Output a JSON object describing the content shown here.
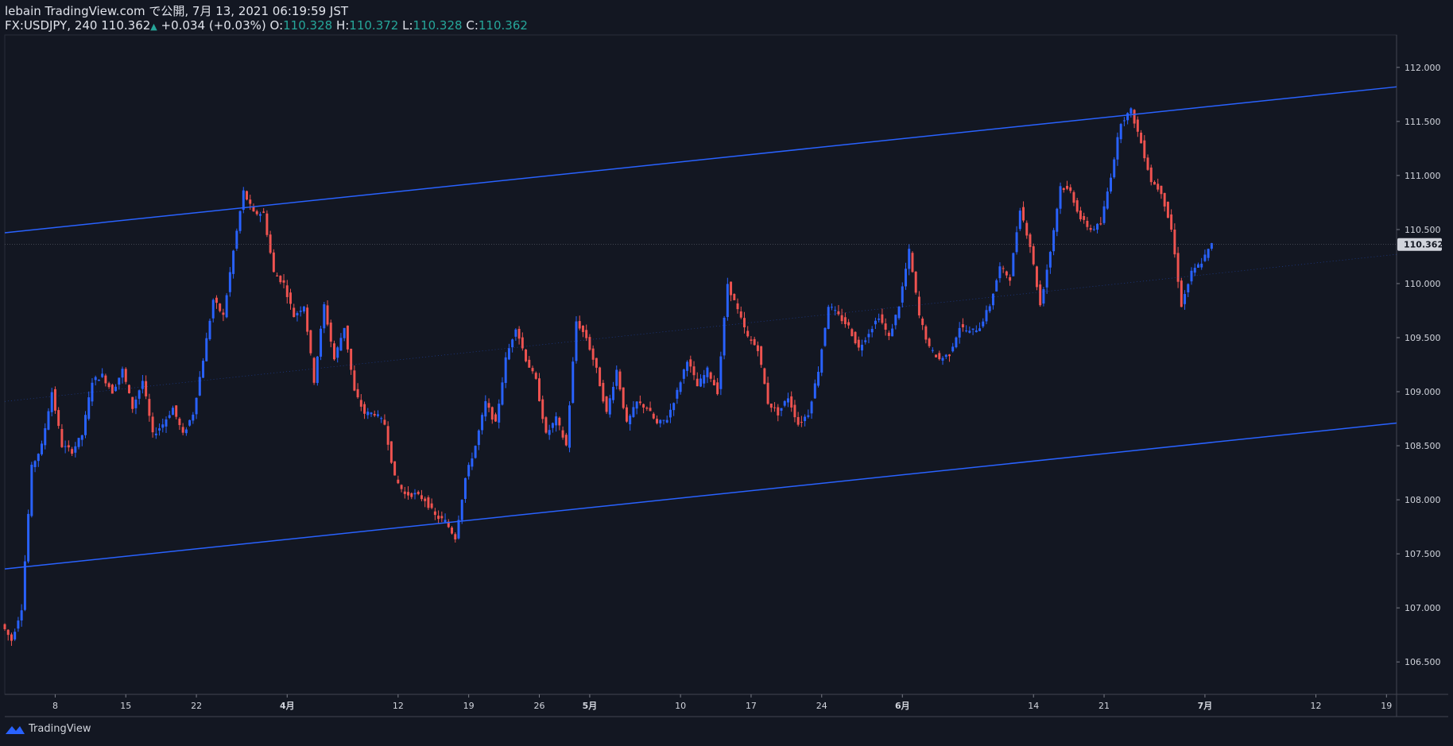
{
  "header": {
    "publish_line": "lebain TradingView.com で公開, 7月 13, 2021 06:19:59 JST",
    "symbol": "FX:USDJPY, 240",
    "last": "110.362",
    "change": "+0.034 (+0.03%)",
    "o_label": "O:",
    "o_value": "110.328",
    "h_label": "H:",
    "h_value": "110.372",
    "l_label": "L:",
    "l_value": "110.328",
    "c_label": "C:",
    "c_value": "110.362"
  },
  "footer": {
    "brand": "TradingView",
    "icon": "tradingview-logo-icon"
  },
  "colors": {
    "background": "#131722",
    "up": "#2962ff",
    "down": "#ef5350",
    "channel": "#2962ff",
    "axis_text": "#d1d4dc",
    "price_label_bg": "#d1d4dc"
  },
  "chart_data": {
    "type": "candlestick",
    "symbol": "FX:USDJPY",
    "interval": "240",
    "ylim": [
      106.2,
      112.3
    ],
    "y_ticks": [
      "106.500",
      "107.000",
      "107.500",
      "108.000",
      "108.500",
      "109.000",
      "109.500",
      "110.000",
      "110.500",
      "111.000",
      "111.500",
      "112.000"
    ],
    "x_ticks": [
      {
        "label": "8",
        "day": 8
      },
      {
        "label": "15",
        "day": 15
      },
      {
        "label": "22",
        "day": 22
      },
      {
        "label": "4月",
        "day": 31
      },
      {
        "label": "12",
        "day": 42
      },
      {
        "label": "19",
        "day": 49
      },
      {
        "label": "26",
        "day": 56
      },
      {
        "label": "5月",
        "day": 61
      },
      {
        "label": "10",
        "day": 70
      },
      {
        "label": "17",
        "day": 77
      },
      {
        "label": "24",
        "day": 84
      },
      {
        "label": "6月",
        "day": 92
      },
      {
        "label": "14",
        "day": 105
      },
      {
        "label": "21",
        "day": 112
      },
      {
        "label": "7月",
        "day": 122
      },
      {
        "label": "12",
        "day": 133
      },
      {
        "label": "19",
        "day": 140
      }
    ],
    "x_range_days": [
      3,
      141
    ],
    "last_price": "110.362",
    "price_path": [
      [
        3,
        106.85
      ],
      [
        4,
        106.7
      ],
      [
        5,
        107.0
      ],
      [
        6,
        108.3
      ],
      [
        7,
        108.5
      ],
      [
        8,
        109.0
      ],
      [
        9,
        108.5
      ],
      [
        10,
        108.45
      ],
      [
        11,
        108.6
      ],
      [
        12,
        109.1
      ],
      [
        13,
        109.15
      ],
      [
        14,
        109.0
      ],
      [
        15,
        109.2
      ],
      [
        16,
        108.85
      ],
      [
        17,
        109.1
      ],
      [
        18,
        108.6
      ],
      [
        19,
        108.7
      ],
      [
        20,
        108.85
      ],
      [
        21,
        108.6
      ],
      [
        22,
        108.8
      ],
      [
        23,
        109.3
      ],
      [
        24,
        109.85
      ],
      [
        25,
        109.7
      ],
      [
        26,
        110.3
      ],
      [
        27,
        110.85
      ],
      [
        28,
        110.65
      ],
      [
        29,
        110.65
      ],
      [
        30,
        110.1
      ],
      [
        31,
        110.0
      ],
      [
        32,
        109.7
      ],
      [
        33,
        109.8
      ],
      [
        34,
        109.1
      ],
      [
        35,
        109.8
      ],
      [
        36,
        109.3
      ],
      [
        37,
        109.6
      ],
      [
        38,
        109.0
      ],
      [
        39,
        108.8
      ],
      [
        40,
        108.8
      ],
      [
        41,
        108.7
      ],
      [
        42,
        108.2
      ],
      [
        43,
        108.05
      ],
      [
        44,
        108.05
      ],
      [
        45,
        108.0
      ],
      [
        46,
        107.85
      ],
      [
        47,
        107.8
      ],
      [
        48,
        107.65
      ],
      [
        49,
        108.2
      ],
      [
        50,
        108.5
      ],
      [
        51,
        108.9
      ],
      [
        52,
        108.7
      ],
      [
        53,
        109.3
      ],
      [
        54,
        109.6
      ],
      [
        55,
        109.3
      ],
      [
        56,
        109.1
      ],
      [
        57,
        108.6
      ],
      [
        58,
        108.75
      ],
      [
        59,
        108.5
      ],
      [
        60,
        109.65
      ],
      [
        61,
        109.5
      ],
      [
        62,
        109.2
      ],
      [
        63,
        108.8
      ],
      [
        64,
        109.2
      ],
      [
        65,
        108.7
      ],
      [
        66,
        108.9
      ],
      [
        67,
        108.85
      ],
      [
        68,
        108.7
      ],
      [
        69,
        108.75
      ],
      [
        70,
        109.0
      ],
      [
        71,
        109.3
      ],
      [
        72,
        109.05
      ],
      [
        73,
        109.2
      ],
      [
        74,
        109.0
      ],
      [
        75,
        110.0
      ],
      [
        76,
        109.75
      ],
      [
        77,
        109.5
      ],
      [
        78,
        109.4
      ],
      [
        79,
        108.9
      ],
      [
        80,
        108.8
      ],
      [
        81,
        108.95
      ],
      [
        82,
        108.7
      ],
      [
        83,
        108.8
      ],
      [
        84,
        109.2
      ],
      [
        85,
        109.8
      ],
      [
        86,
        109.7
      ],
      [
        87,
        109.6
      ],
      [
        88,
        109.4
      ],
      [
        89,
        109.55
      ],
      [
        90,
        109.7
      ],
      [
        91,
        109.5
      ],
      [
        92,
        109.8
      ],
      [
        93,
        110.3
      ],
      [
        94,
        109.7
      ],
      [
        95,
        109.4
      ],
      [
        96,
        109.3
      ],
      [
        97,
        109.35
      ],
      [
        98,
        109.6
      ],
      [
        99,
        109.55
      ],
      [
        100,
        109.6
      ],
      [
        101,
        109.8
      ],
      [
        102,
        110.15
      ],
      [
        103,
        110.05
      ],
      [
        104,
        110.7
      ],
      [
        105,
        110.35
      ],
      [
        106,
        109.8
      ],
      [
        107,
        110.3
      ],
      [
        108,
        110.9
      ],
      [
        109,
        110.85
      ],
      [
        110,
        110.6
      ],
      [
        111,
        110.5
      ],
      [
        112,
        110.55
      ],
      [
        113,
        111.0
      ],
      [
        114,
        111.5
      ],
      [
        115,
        111.6
      ],
      [
        116,
        111.3
      ],
      [
        117,
        110.95
      ],
      [
        118,
        110.85
      ],
      [
        119,
        110.5
      ],
      [
        120,
        109.8
      ],
      [
        121,
        110.1
      ],
      [
        122,
        110.2
      ],
      [
        123,
        110.36
      ]
    ],
    "channel_lines": [
      {
        "name": "upper",
        "from": [
          3,
          110.47
        ],
        "to": [
          141,
          111.82
        ]
      },
      {
        "name": "lower",
        "from": [
          3,
          107.36
        ],
        "to": [
          141,
          108.71
        ]
      },
      {
        "name": "mid",
        "from": [
          3,
          108.91
        ],
        "to": [
          141,
          110.27
        ],
        "dotted": true
      }
    ],
    "grid": false,
    "legend": "none"
  }
}
